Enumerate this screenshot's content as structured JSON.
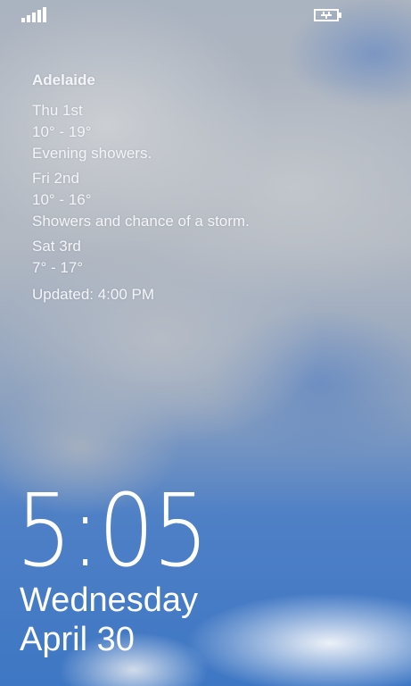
{
  "status_bar": {
    "signal_icon": "signal-strength-icon",
    "battery_icon": "battery-charging-icon"
  },
  "weather": {
    "city": "Adelaide",
    "days": [
      {
        "day": "Thu 1st",
        "range": "10° - 19°",
        "summary": "Evening showers."
      },
      {
        "day": "Fri 2nd",
        "range": "10° - 16°",
        "summary": "Showers and chance of a storm."
      },
      {
        "day": "Sat 3rd",
        "range": "7° - 17°",
        "summary": ""
      }
    ],
    "updated": "Updated: 4:00 PM"
  },
  "lock": {
    "time": "5:05",
    "day": "Wednesday",
    "date": "April 30"
  },
  "colors": {
    "text": "#ffffff",
    "sky": "#3e77c4",
    "cloud": "#c4c8cf"
  }
}
